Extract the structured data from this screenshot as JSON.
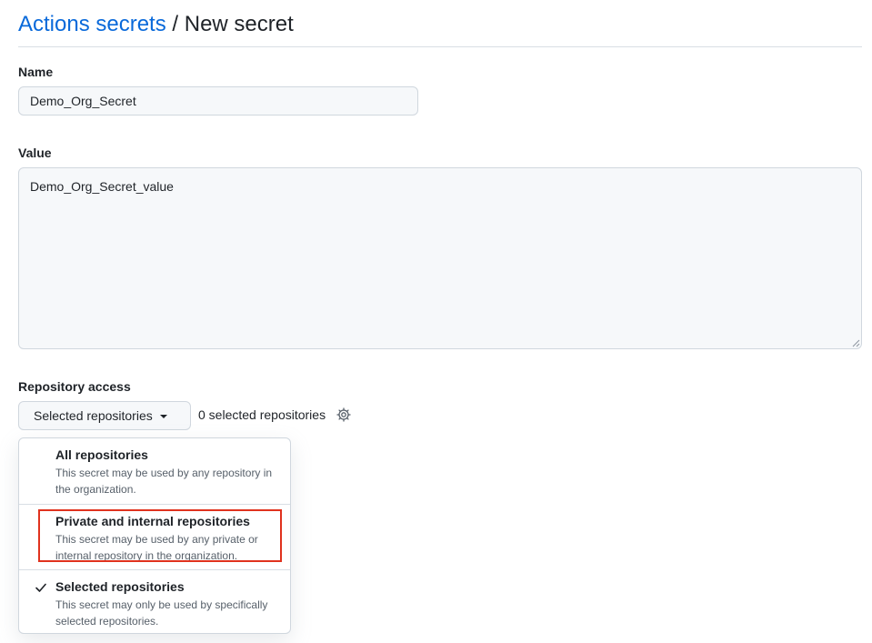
{
  "breadcrumb": {
    "parent": "Actions secrets",
    "separator": "/",
    "current": "New secret"
  },
  "form": {
    "name_label": "Name",
    "name_value": "Demo_Org_Secret",
    "value_label": "Value",
    "value_value": "Demo_Org_Secret_value",
    "access_label": "Repository access",
    "access_selected": "Selected repositories",
    "selected_count_text": "0 selected repositories"
  },
  "access_menu": {
    "items": [
      {
        "title": "All repositories",
        "description": "This secret may be used by any repository in the organization.",
        "checked": false
      },
      {
        "title": "Private and internal repositories",
        "description": "This secret may be used by any private or internal repository in the organization.",
        "checked": false
      },
      {
        "title": "Selected repositories",
        "description": "This secret may only be used by specifically selected repositories.",
        "checked": true
      }
    ]
  },
  "icons": {
    "dropdown": "triangle-down-icon",
    "settings": "gear-icon",
    "checked": "check-icon"
  },
  "colors": {
    "link": "#0969da",
    "highlight": "#e0321e"
  }
}
